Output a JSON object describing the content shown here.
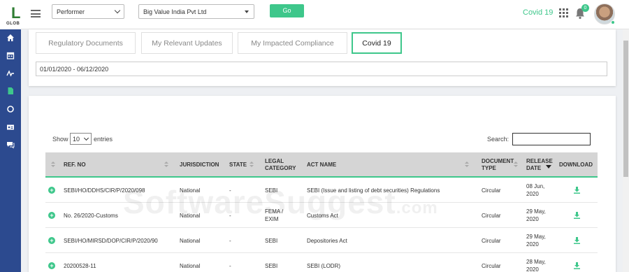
{
  "brand": {
    "logo_letter": "L",
    "logo_sub": "GLOB"
  },
  "colors": {
    "accent": "#3ec78b",
    "sidebar": "#2c4a8f",
    "header_bg": "#d5d5d5"
  },
  "sidebar": {
    "items": [
      {
        "icon": "home-icon"
      },
      {
        "icon": "calendar-icon"
      },
      {
        "icon": "activity-icon"
      },
      {
        "icon": "document-icon"
      },
      {
        "icon": "circle-icon"
      },
      {
        "icon": "id-card-icon"
      },
      {
        "icon": "chat-icon"
      }
    ]
  },
  "topbar": {
    "role_select": "Performer",
    "entity_select": "Big Value India Pvt Ltd",
    "go_label": "Go",
    "covid_link": "Covid 19",
    "notification_count": "0"
  },
  "tabs": [
    {
      "label": "Regulatory Documents",
      "active": false
    },
    {
      "label": "My Relevant Updates",
      "active": false
    },
    {
      "label": "My Impacted Compliance",
      "active": false
    },
    {
      "label": "Covid 19",
      "active": true
    }
  ],
  "date_range": "01/01/2020 - 06/12/2020",
  "table_controls": {
    "show_label": "Show",
    "entries_value": "10",
    "entries_label": "entries",
    "search_label": "Search:"
  },
  "table": {
    "columns": [
      "REF. NO",
      "JURISDICTION",
      "STATE",
      "LEGAL CATEGORY",
      "ACT NAME",
      "DOCUMENT TYPE",
      "RELEASE DATE",
      "DOWNLOAD"
    ],
    "col_lines": {
      "legal_1": "LEGAL",
      "legal_2": "CATEGORY",
      "doc_1": "DOCUMENT",
      "doc_2": "TYPE",
      "rel_1": "RELEASE",
      "rel_2": "DATE"
    },
    "rows": [
      {
        "ref": "SEBI/HO/DDHS/CIR/P/2020/098",
        "jurisdiction": "National",
        "state": "-",
        "cat1": "SEBI",
        "cat2": "",
        "act": "SEBI (Issue and listing of debt securities) Regulations",
        "type": "Circular",
        "date1": "08 Jun,",
        "date2": "2020"
      },
      {
        "ref": "No. 26/2020-Customs",
        "jurisdiction": "National",
        "state": "-",
        "cat1": "FEMA /",
        "cat2": "EXIM",
        "act": "Customs Act",
        "type": "Circular",
        "date1": "29 May,",
        "date2": "2020"
      },
      {
        "ref": "SEBI/HO/MIRSD/DOP/CIR/P/2020/90",
        "jurisdiction": "National",
        "state": "-",
        "cat1": "SEBI",
        "cat2": "",
        "act": "Depositories Act",
        "type": "Circular",
        "date1": "29 May,",
        "date2": "2020"
      },
      {
        "ref": "20200528-11",
        "jurisdiction": "National",
        "state": "-",
        "cat1": "SEBI",
        "cat2": "",
        "act": "SEBI (LODR)",
        "type": "Circular",
        "date1": "28 May,",
        "date2": "2020"
      }
    ]
  },
  "watermark": {
    "main": "SoftwareSuggest",
    "suffix": ".com"
  }
}
